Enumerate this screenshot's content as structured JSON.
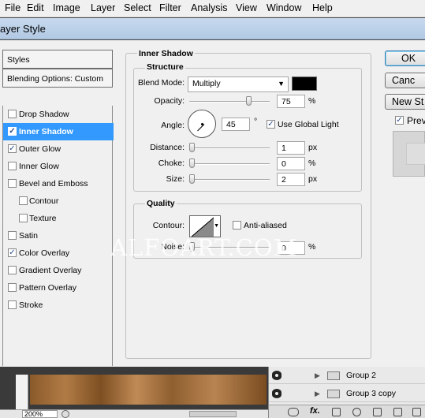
{
  "menubar": [
    "File",
    "Edit",
    "Image",
    "Layer",
    "Select",
    "Filter",
    "Analysis",
    "View",
    "Window",
    "Help"
  ],
  "window_title": "ayer Style",
  "styles_list": {
    "header": "Styles",
    "blending": "Blending Options: Custom",
    "items": [
      {
        "label": "Drop Shadow",
        "checked": false,
        "sub": false,
        "selected": false
      },
      {
        "label": "Inner Shadow",
        "checked": true,
        "sub": false,
        "selected": true
      },
      {
        "label": "Outer Glow",
        "checked": true,
        "sub": false,
        "selected": false
      },
      {
        "label": "Inner Glow",
        "checked": false,
        "sub": false,
        "selected": false
      },
      {
        "label": "Bevel and Emboss",
        "checked": false,
        "sub": false,
        "selected": false
      },
      {
        "label": "Contour",
        "checked": false,
        "sub": true,
        "selected": false
      },
      {
        "label": "Texture",
        "checked": false,
        "sub": true,
        "selected": false
      },
      {
        "label": "Satin",
        "checked": false,
        "sub": false,
        "selected": false
      },
      {
        "label": "Color Overlay",
        "checked": true,
        "sub": false,
        "selected": false
      },
      {
        "label": "Gradient Overlay",
        "checked": false,
        "sub": false,
        "selected": false
      },
      {
        "label": "Pattern Overlay",
        "checked": false,
        "sub": false,
        "selected": false
      },
      {
        "label": "Stroke",
        "checked": false,
        "sub": false,
        "selected": false
      }
    ]
  },
  "inner_shadow": {
    "title": "Inner Shadow",
    "structure": {
      "title": "Structure",
      "blend_mode_label": "Blend Mode:",
      "blend_mode": "Multiply",
      "shadow_color": "#000000",
      "opacity_label": "Opacity:",
      "opacity": "75",
      "opacity_unit": "%",
      "angle_label": "Angle:",
      "angle": "45",
      "angle_unit": "°",
      "global_light_label": "Use Global Light",
      "global_light_checked": true,
      "distance_label": "Distance:",
      "distance": "1",
      "distance_unit": "px",
      "choke_label": "Choke:",
      "choke": "0",
      "choke_unit": "%",
      "size_label": "Size:",
      "size": "2",
      "size_unit": "px"
    },
    "quality": {
      "title": "Quality",
      "contour_label": "Contour:",
      "antialiased_label": "Anti-aliased",
      "antialiased_checked": false,
      "noise_label": "Noise:",
      "noise": "0",
      "noise_unit": "%"
    }
  },
  "buttons": {
    "ok": "OK",
    "cancel": "Canc",
    "new_style": "New St",
    "preview": "Prev",
    "preview_checked": true
  },
  "watermark": "ALFOART.COM",
  "bottom": {
    "zoom": "200%",
    "layers": [
      "Group 2",
      "Group 3 copy"
    ],
    "layer_tools": [
      "link",
      "fx",
      "mask",
      "adjustment",
      "group",
      "new",
      "delete"
    ]
  },
  "colors": {
    "selection": "#3399ff",
    "dialog_bg": "#f0f0f0",
    "titlebar": "#b8cde6"
  }
}
